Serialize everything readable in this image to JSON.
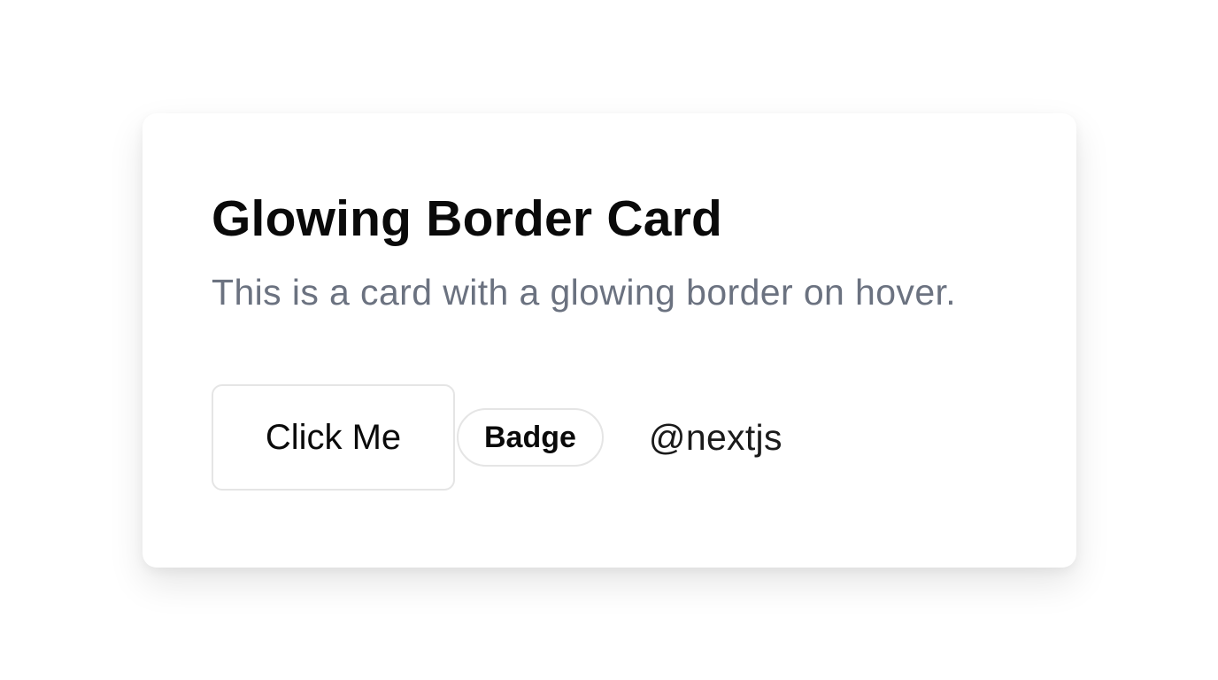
{
  "card": {
    "title": "Glowing Border Card",
    "description": "This is a card with a glowing border on hover.",
    "button_label": "Click Me",
    "badge_label": "Badge",
    "handle": "@nextjs"
  }
}
